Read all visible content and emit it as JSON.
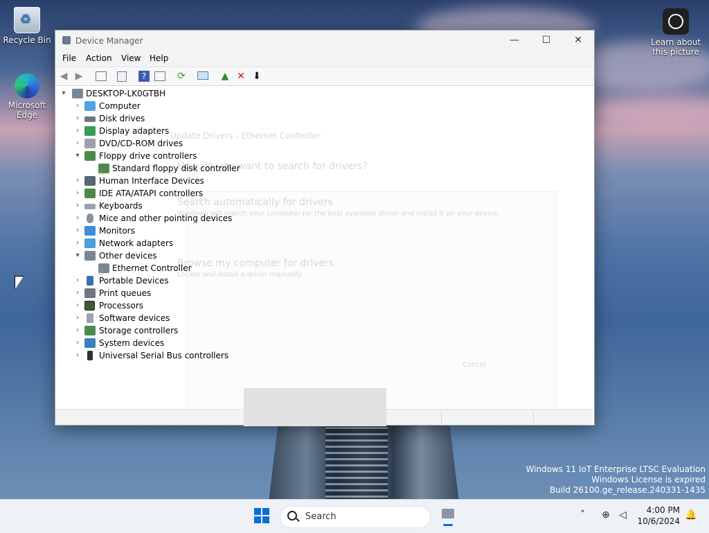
{
  "desktop": {
    "icons": [
      {
        "label": "Recycle Bin"
      },
      {
        "label": "Microsoft Edge"
      }
    ],
    "learn_label": "Learn about this picture",
    "watermark": {
      "line1": "Windows 11 IoT Enterprise LTSC Evaluation",
      "line2": "Windows License is expired",
      "line3": "Build 26100.ge_release.240331-1435"
    }
  },
  "window": {
    "title": "Device Manager",
    "controls": {
      "minimize": "—",
      "maximize": "☐",
      "close": "✕"
    },
    "menu": [
      "File",
      "Action",
      "View",
      "Help"
    ],
    "toolbar_icons": [
      "back-icon",
      "forward-icon",
      "show-hide-tree-icon",
      "properties-icon",
      "help-icon",
      "action-pane-icon",
      "update-driver-icon",
      "scan-hardware-icon",
      "add-legacy-icon",
      "uninstall-icon",
      "disable-icon"
    ],
    "tree": {
      "root": "DESKTOP-LK0GTBH",
      "items": [
        {
          "label": "Computer",
          "expanded": false
        },
        {
          "label": "Disk drives",
          "expanded": false
        },
        {
          "label": "Display adapters",
          "expanded": false
        },
        {
          "label": "DVD/CD-ROM drives",
          "expanded": false
        },
        {
          "label": "Floppy drive controllers",
          "expanded": true
        },
        {
          "label": "Standard floppy disk controller",
          "child": true,
          "warning": true
        },
        {
          "label": "Human Interface Devices",
          "expanded": false
        },
        {
          "label": "IDE ATA/ATAPI controllers",
          "expanded": false
        },
        {
          "label": "Keyboards",
          "expanded": false
        },
        {
          "label": "Mice and other pointing devices",
          "expanded": false
        },
        {
          "label": "Monitors",
          "expanded": false
        },
        {
          "label": "Network adapters",
          "expanded": false
        },
        {
          "label": "Other devices",
          "expanded": true
        },
        {
          "label": "Ethernet Controller",
          "child": true,
          "warning": true
        },
        {
          "label": "Portable Devices",
          "expanded": false
        },
        {
          "label": "Print queues",
          "expanded": false
        },
        {
          "label": "Processors",
          "expanded": false
        },
        {
          "label": "Software devices",
          "expanded": false
        },
        {
          "label": "Storage controllers",
          "expanded": false
        },
        {
          "label": "System devices",
          "expanded": false
        },
        {
          "label": "Universal Serial Bus controllers",
          "expanded": false
        }
      ]
    },
    "ghost_dialog": {
      "title": "Update Drivers - Ethernet Controller",
      "question": "How do you want to search for drivers?",
      "option1": "Search automatically for drivers",
      "option1_desc": "Windows will search your computer for the best available driver and install it on your device.",
      "option2": "Browse my computer for drivers",
      "option2_desc": "Locate and install a driver manually.",
      "cancel": "Cancel"
    }
  },
  "taskbar": {
    "search_placeholder": "Search",
    "time": "4:00 PM",
    "date": "10/6/2024"
  },
  "colors": {
    "accent": "#0a6fd6",
    "warning": "#f2b705"
  }
}
